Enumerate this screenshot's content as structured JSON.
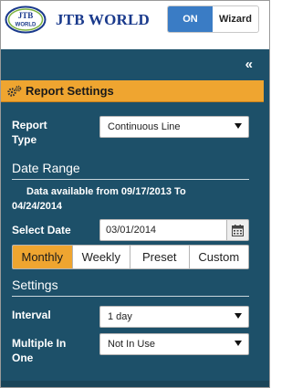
{
  "header": {
    "logo_text": "JTB WORLD",
    "brand": "JTB WORLD",
    "toggle_on": "ON",
    "toggle_wizard": "Wizard"
  },
  "panel": {
    "collapse_glyph": "«",
    "section_title": "Report Settings",
    "report_type": {
      "label_line1": "Report",
      "label_line2": "Type",
      "value": "Continuous Line"
    },
    "date_range": {
      "heading": "Date Range",
      "note_line1": "Data available from 09/17/2013 To",
      "note_line2": "04/24/2014",
      "select_date_label": "Select Date",
      "select_date_value": "03/01/2014",
      "periods": [
        "Monthly",
        "Weekly",
        "Preset",
        "Custom"
      ],
      "active_period": "Monthly"
    },
    "settings": {
      "heading": "Settings",
      "interval_label": "Interval",
      "interval_value": "1 day",
      "multiple_label_line1": "Multiple In",
      "multiple_label_line2": "One",
      "multiple_value": "Not In Use"
    }
  },
  "colors": {
    "panel_bg": "#1d5069",
    "accent": "#efa530",
    "toggle_on": "#3a7cc5",
    "brand": "#1a3a8c"
  },
  "icons": {
    "logo": "jtb-logo-icon",
    "gears": "gears-icon",
    "calendar": "calendar-icon",
    "dropdown": "dropdown-arrow-icon",
    "collapse": "double-chevron-left-icon"
  }
}
